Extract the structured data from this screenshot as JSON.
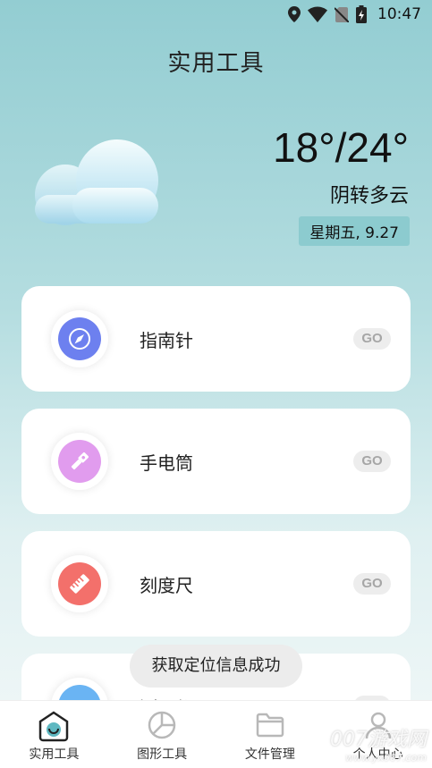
{
  "status_bar": {
    "time": "10:47",
    "icons": [
      "location-icon",
      "wifi-icon",
      "no-sim-icon",
      "battery-charging-icon"
    ]
  },
  "page": {
    "title": "实用工具"
  },
  "weather": {
    "icon": "cloud-icon",
    "temperature": "18°/24°",
    "condition": "阴转多云",
    "date": "星期五, 9.27"
  },
  "tools": [
    {
      "label": "指南针",
      "go": "GO",
      "icon": "compass-icon",
      "color": "#6d80ef"
    },
    {
      "label": "手电筒",
      "go": "GO",
      "icon": "flashlight-icon",
      "color": "#e19cee"
    },
    {
      "label": "刻度尺",
      "go": "GO",
      "icon": "ruler-icon",
      "color": "#f3706b"
    },
    {
      "label": "测距仪",
      "go": "GO",
      "icon": "rangefinder-icon",
      "color": "#6ab4f3"
    }
  ],
  "toast": "获取定位信息成功",
  "bottom_nav": [
    {
      "label": "实用工具",
      "icon": "home-icon",
      "active": true
    },
    {
      "label": "图形工具",
      "icon": "pie-chart-icon",
      "active": false
    },
    {
      "label": "文件管理",
      "icon": "folder-icon",
      "active": false
    },
    {
      "label": "个人中心",
      "icon": "user-icon",
      "active": false
    }
  ],
  "watermark": {
    "text": "007游戏网",
    "sub": "www.yx007.com"
  },
  "colors": {
    "accent": "#5fb8c1",
    "background_top": "#93cdd2",
    "badge": "#8ccbcf"
  }
}
